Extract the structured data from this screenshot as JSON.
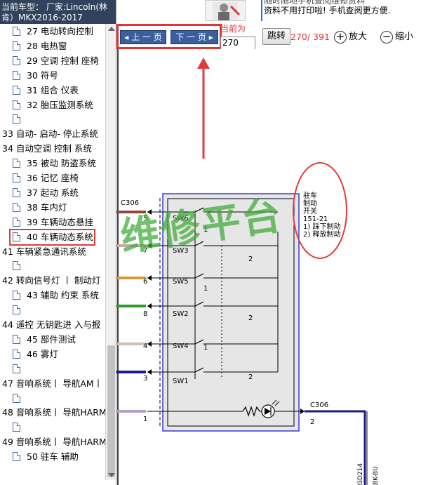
{
  "header": {
    "car_model": "当前车型： 厂家:Lincoln(林肯）MKX2016-2017"
  },
  "banner": {
    "line1": "随时随地手机查阅维修资料",
    "line2": "资料不用打印啦! 手机查阅更方便."
  },
  "toolbar": {
    "prev_label": "上 一 页",
    "next_label": "下 一 页",
    "current_label": "当前为",
    "page_value": "270",
    "jump_label": "跳转",
    "page_count": "270/ 391",
    "zoom_in_label": "放大",
    "zoom_out_label": "缩小"
  },
  "tree": [
    {
      "type": "child",
      "label": "27 电动转向控制"
    },
    {
      "type": "child",
      "label": "28 电热窗"
    },
    {
      "type": "child",
      "label": "29 空调 控制 座椅"
    },
    {
      "type": "child",
      "label": "30 符号"
    },
    {
      "type": "child",
      "label": "31 组合 仪表"
    },
    {
      "type": "child",
      "label": "32 胎压监测系统"
    },
    {
      "type": "blank",
      "label": ""
    },
    {
      "type": "parent",
      "label": "33 自动- 启动- 停止系统"
    },
    {
      "type": "parent",
      "label": "34 自动空调 控制 系统"
    },
    {
      "type": "child",
      "label": "35 被动 防盗系统"
    },
    {
      "type": "child",
      "label": "36 记忆 座椅"
    },
    {
      "type": "child",
      "label": "37 起动 系统"
    },
    {
      "type": "child",
      "label": "38 车内灯"
    },
    {
      "type": "child",
      "label": "39 车辆动态悬挂"
    },
    {
      "type": "child",
      "label": "40 车辆动态系统",
      "selected": true
    },
    {
      "type": "parent",
      "label": "41 车辆紧急通讯系统"
    },
    {
      "type": "blank",
      "label": ""
    },
    {
      "type": "parent",
      "label": "42 转向信号灯 丨 制动灯"
    },
    {
      "type": "child",
      "label": "43 辅助 约束 系统"
    },
    {
      "type": "blank",
      "label": ""
    },
    {
      "type": "parent",
      "label": "44 遥控 无钥匙进 入与报"
    },
    {
      "type": "child",
      "label": "45 部件测试"
    },
    {
      "type": "child",
      "label": "46 雾灯"
    },
    {
      "type": "blank",
      "label": ""
    },
    {
      "type": "parent",
      "label": "47 音响系统丨 导航AM丨"
    },
    {
      "type": "blank",
      "label": ""
    },
    {
      "type": "parent",
      "label": "48 音响系统丨 导航HARM"
    },
    {
      "type": "blank",
      "label": ""
    },
    {
      "type": "parent",
      "label": "49 音响系统丨 导航HARM"
    },
    {
      "type": "child",
      "label": "50 驻车 辅助"
    }
  ],
  "diagram": {
    "watermark": "维修平台",
    "connector_top": "C306",
    "connector_bottom": "C306",
    "connector_bottom_pin": "2",
    "switches": [
      "SW6",
      "SW3",
      "SW5",
      "SW2",
      "SW4",
      "SW1"
    ],
    "pins": [
      "5",
      "7",
      "6",
      "8",
      "4",
      "3",
      "1"
    ],
    "pos_labels": [
      "1",
      "2",
      "1",
      "2",
      "1",
      "2"
    ],
    "callout": [
      "驻车",
      "制动",
      "开关",
      "151-21",
      "1) 踩下制动",
      "2) 释放制动"
    ],
    "wire_labels": [
      "GD214",
      "BK-BU"
    ],
    "colors": {
      "accent_red": "#e03333",
      "nav_blue": "#3b5f9e",
      "header_bg": "#31435c",
      "watermark": "#3caa35",
      "module_border": "#3a3ad6"
    }
  }
}
